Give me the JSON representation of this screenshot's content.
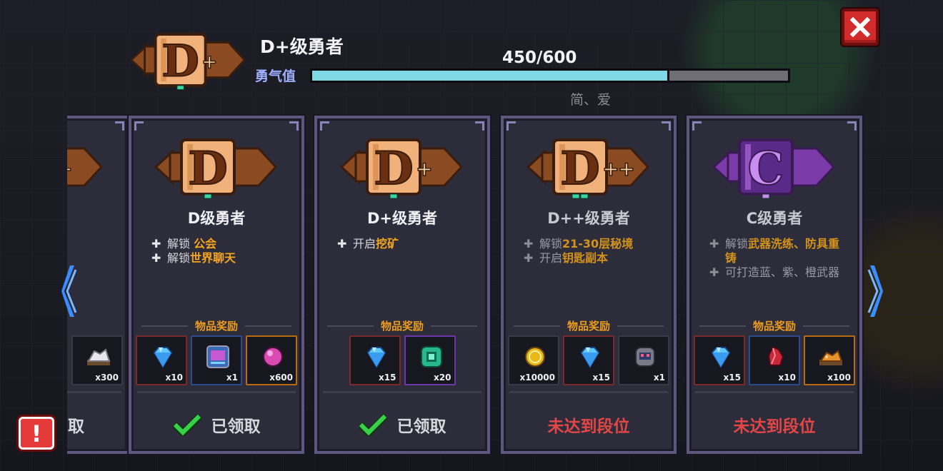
{
  "header": {
    "rank_title": "D+级勇者",
    "courage_label": "勇气值",
    "progress_text": "450/600",
    "progress_ratio": 0.75,
    "author": "简、爱"
  },
  "colors": {
    "progress_fill": "#7fd9e4",
    "claimed_status": "#d8d8dc",
    "locked_status": "#e24646",
    "highlight": "#f5a51e"
  },
  "cards": [
    {
      "title": "",
      "perks": [],
      "reward_label": "",
      "rewards": [
        {
          "icon": "silver-ore-icon",
          "qty": "x300"
        }
      ],
      "status": "取",
      "state": "claimed"
    },
    {
      "title": "D级勇者",
      "perks": [
        {
          "prefix": "解锁 ",
          "highlight": "公会",
          "suffix": ""
        },
        {
          "prefix": "解锁",
          "highlight": "世界聊天",
          "suffix": ""
        }
      ],
      "reward_label": "物品奖励",
      "rewards": [
        {
          "icon": "blue-gem-icon",
          "qty": "x10"
        },
        {
          "icon": "blueprint-icon",
          "qty": "x1"
        },
        {
          "icon": "pink-gem-icon",
          "qty": "x600"
        }
      ],
      "status": "已领取",
      "state": "claimed"
    },
    {
      "title": "D+级勇者",
      "perks": [
        {
          "prefix": "开启",
          "highlight": "挖矿",
          "suffix": ""
        }
      ],
      "reward_label": "物品奖励",
      "rewards": [
        {
          "icon": "blue-gem-icon",
          "qty": "x15"
        },
        {
          "icon": "green-chip-icon",
          "qty": "x20"
        }
      ],
      "status": "已领取",
      "state": "claimed"
    },
    {
      "title": "D++级勇者",
      "perks": [
        {
          "prefix": "解锁",
          "highlight": "21-30层秘境",
          "suffix": ""
        },
        {
          "prefix": "开启",
          "highlight": "钥匙副本",
          "suffix": ""
        }
      ],
      "reward_label": "物品奖励",
      "rewards": [
        {
          "icon": "gold-coin-icon",
          "qty": "x10000"
        },
        {
          "icon": "blue-gem-icon",
          "qty": "x15"
        },
        {
          "icon": "robot-icon",
          "qty": "x1"
        }
      ],
      "status": "未达到段位",
      "state": "locked"
    },
    {
      "title": "C级勇者",
      "perks": [
        {
          "prefix": "解锁",
          "highlight": "武器洗练、防具重铸",
          "suffix": ""
        },
        {
          "prefix": "可打造蓝、紫、橙武器",
          "highlight": "",
          "suffix": ""
        }
      ],
      "reward_label": "物品奖励",
      "rewards": [
        {
          "icon": "blue-gem-icon",
          "qty": "x15"
        },
        {
          "icon": "red-crystal-icon",
          "qty": "x10"
        },
        {
          "icon": "orange-ore-icon",
          "qty": "x100"
        }
      ],
      "status": "未达到段位",
      "state": "locked"
    }
  ],
  "badges": {
    "header": "D+",
    "cards": [
      "D+",
      "D",
      "D+",
      "D++",
      "C"
    ]
  },
  "icons": {
    "close": "close-icon",
    "prev": "chevron-left-icon",
    "next": "chevron-right-icon",
    "warning": "exclamation-icon",
    "check": "check-icon"
  },
  "warning_glyph": "!"
}
